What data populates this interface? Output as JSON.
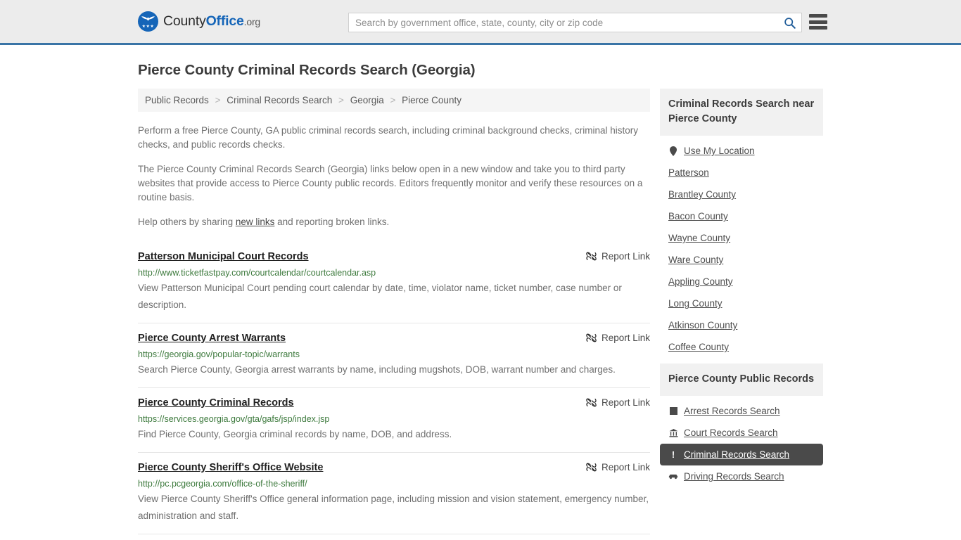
{
  "header": {
    "brand": {
      "part1": "County",
      "part2": "Office",
      "part3": ".org",
      "logo_icon": "eagle-seal-icon"
    },
    "search": {
      "value": "",
      "placeholder": "Search by government office, state, county, city or zip code",
      "icon": "search-icon"
    },
    "menu_icon": "hamburger-menu-icon",
    "accent_color": "#3a74a6",
    "background_color": "#ececec"
  },
  "page_title": "Pierce County Criminal Records Search (Georgia)",
  "breadcrumb": {
    "separator": ">",
    "items": [
      {
        "label": "Public Records"
      },
      {
        "label": "Criminal Records Search"
      },
      {
        "label": "Georgia"
      },
      {
        "label": "Pierce County"
      }
    ]
  },
  "intro": {
    "p1": "Perform a free Pierce County, GA public criminal records search, including criminal background checks, criminal history checks, and public records checks.",
    "p2": "The Pierce County Criminal Records Search (Georgia) links below open in a new window and take you to third party websites that provide access to Pierce County public records. Editors frequently monitor and verify these resources on a routine basis.",
    "p3_before": "Help others by sharing ",
    "p3_link": "new links",
    "p3_after": " and reporting broken links."
  },
  "report_link": {
    "label": "Report Link",
    "icon": "broken-link-icon"
  },
  "results": [
    {
      "title": "Patterson Municipal Court Records",
      "url": "http://www.ticketfastpay.com/courtcalendar/courtcalendar.asp",
      "description": "View Patterson Municipal Court pending court calendar by date, time, violator name, ticket number, case number or description."
    },
    {
      "title": "Pierce County Arrest Warrants",
      "url": "https://georgia.gov/popular-topic/warrants",
      "description": "Search Pierce County, Georgia arrest warrants by name, including mugshots, DOB, warrant number and charges."
    },
    {
      "title": "Pierce County Criminal Records",
      "url": "https://services.georgia.gov/gta/gafs/jsp/index.jsp",
      "description": "Find Pierce County, Georgia criminal records by name, DOB, and address."
    },
    {
      "title": "Pierce County Sheriff's Office Website",
      "url": "http://pc.pcgeorgia.com/office-of-the-sheriff/",
      "description": "View Pierce County Sheriff's Office general information page, including mission and vision statement, emergency number, administration and staff."
    }
  ],
  "sidebar": {
    "nearby": {
      "heading": "Criminal Records Search near Pierce County",
      "items": [
        {
          "label": "Use My Location",
          "icon": "map-pin-icon"
        },
        {
          "label": "Patterson",
          "icon": ""
        },
        {
          "label": "Brantley County",
          "icon": ""
        },
        {
          "label": "Bacon County",
          "icon": ""
        },
        {
          "label": "Wayne County",
          "icon": ""
        },
        {
          "label": "Ware County",
          "icon": ""
        },
        {
          "label": "Appling County",
          "icon": ""
        },
        {
          "label": "Long County",
          "icon": ""
        },
        {
          "label": "Atkinson County",
          "icon": ""
        },
        {
          "label": "Coffee County",
          "icon": ""
        }
      ]
    },
    "public_records": {
      "heading": "Pierce County Public Records",
      "active_color": "#4a4a4a",
      "items": [
        {
          "label": "Arrest Records Search",
          "icon": "fingerprint-square-icon",
          "active": false
        },
        {
          "label": "Court Records Search",
          "icon": "courthouse-icon",
          "active": false
        },
        {
          "label": "Criminal Records Search",
          "icon": "exclamation-icon",
          "active": true
        },
        {
          "label": "Driving Records Search",
          "icon": "car-icon",
          "active": false
        }
      ]
    }
  }
}
